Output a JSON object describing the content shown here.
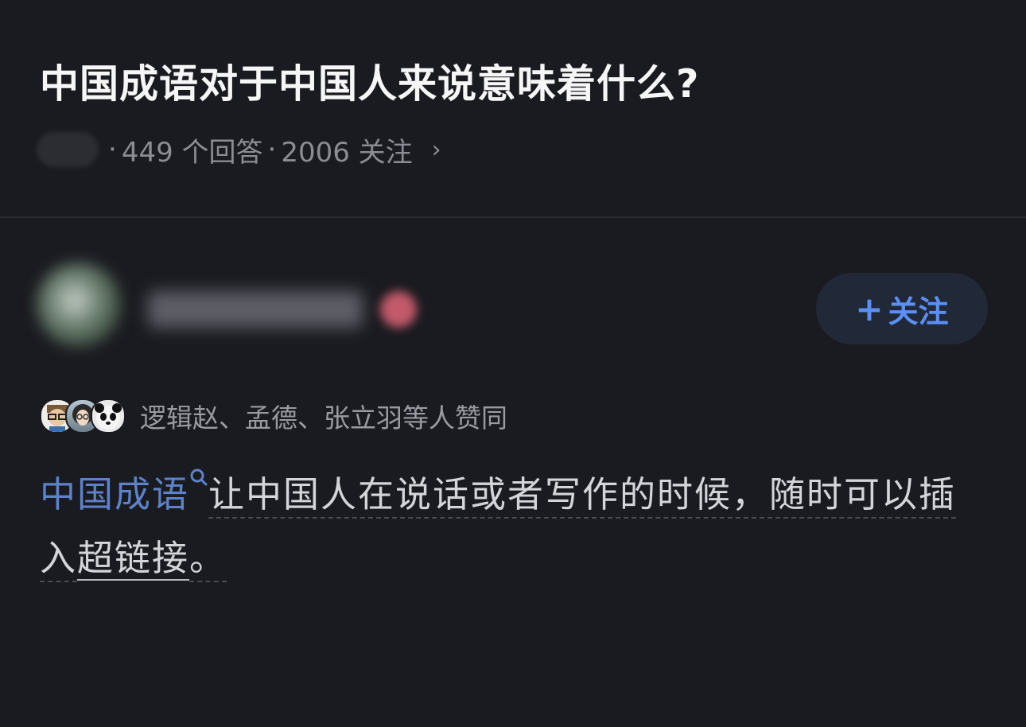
{
  "question": {
    "title": "中国成语对于中国人来说意味着什么?",
    "answers_count": "449 个回答",
    "followers_count": "2006 关注",
    "separator": "·",
    "chevron": "›"
  },
  "author": {
    "follow_plus": "+",
    "follow_label": "关注"
  },
  "endorsement": {
    "text": "逻辑赵、孟德、张立羽等人赞同",
    "avatar_icons": [
      "cartoon-glasses-avatar-icon",
      "woman-glasses-avatar-icon",
      "panda-avatar-icon"
    ]
  },
  "answer": {
    "term": "中国成语",
    "text_before_link": "让中国人在说话或者写作的时候，随时可以插入",
    "link_text": "超链接",
    "text_end": "。"
  },
  "colors": {
    "background": "#1a1b20",
    "accent": "#5b8ff4",
    "term": "#5d82c8",
    "follow_bg": "#212838"
  }
}
